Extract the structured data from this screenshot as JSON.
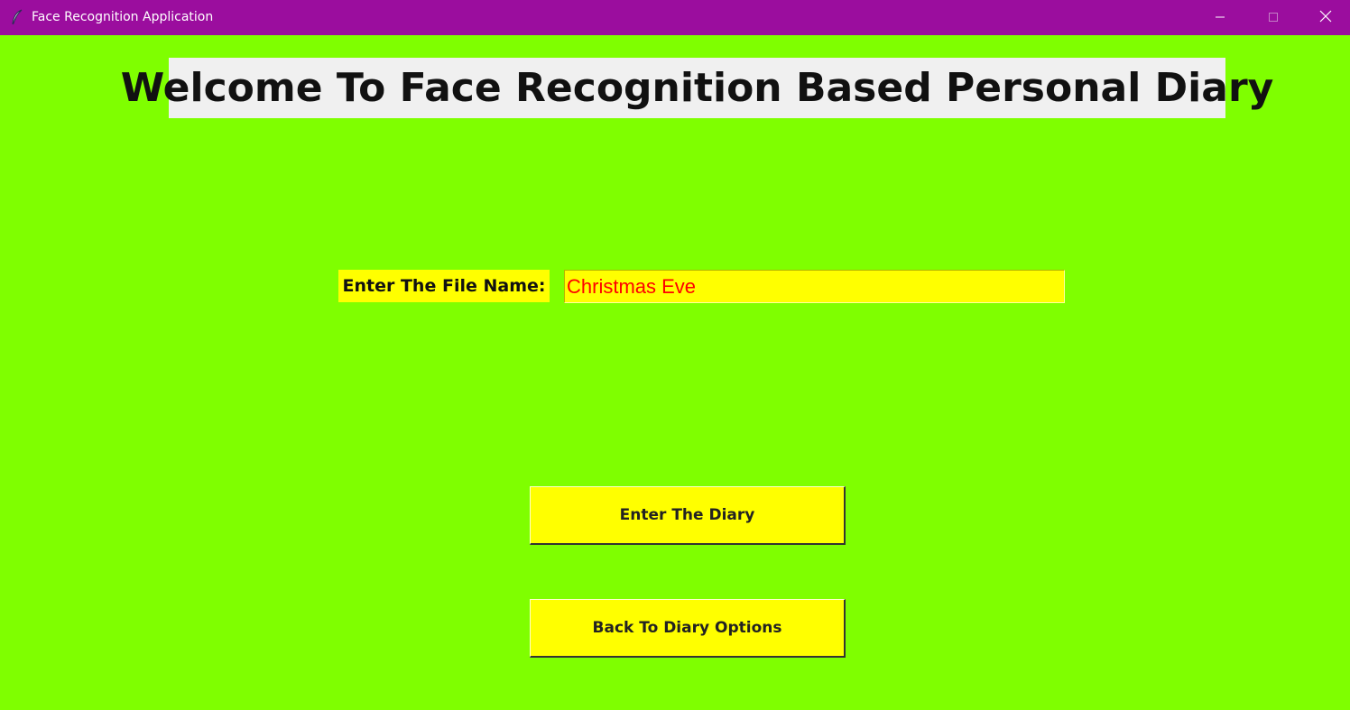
{
  "window": {
    "title": "Face Recognition Application",
    "icons": {
      "app": "feather-icon",
      "minimize": "minimize-icon",
      "maximize": "maximize-icon",
      "close": "close-icon"
    },
    "colors": {
      "titlebar": "#9b0d9e",
      "background": "#7fff00"
    }
  },
  "main": {
    "heading": "Welcome To Face Recognition Based Personal Diary",
    "file_label": "Enter The File Name:",
    "file_input_value": "Christmas Eve",
    "colors": {
      "widget_background": "#ffff00",
      "input_text": "#ff0000",
      "heading_background": "#f0f0f0"
    }
  },
  "buttons": {
    "enter_diary": "Enter The Diary",
    "back_options": "Back To Diary Options"
  }
}
